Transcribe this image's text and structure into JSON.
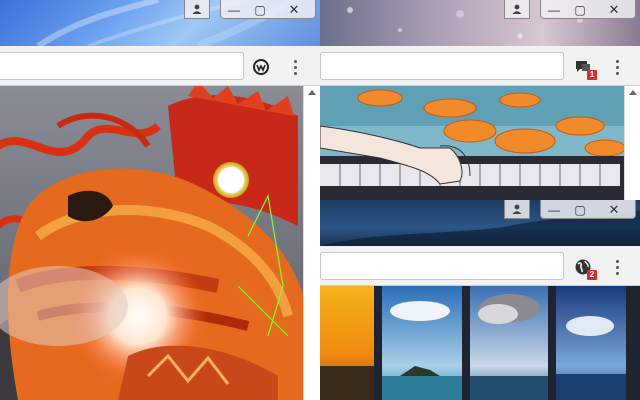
{
  "windows": [
    {
      "id": "dragon",
      "icons": {
        "profile": "person-icon",
        "extension": "workplace-icon"
      },
      "menu_label": "⋮"
    },
    {
      "id": "koi",
      "icons": {
        "profile": "person-icon",
        "extension": "chat-bubble-icon"
      },
      "badge": "1"
    },
    {
      "id": "sea",
      "icons": {
        "profile": "person-icon",
        "extension": "globe-icon"
      },
      "badge": "2"
    }
  ],
  "controls": {
    "minimize": "—",
    "maximize": "▢",
    "close": "✕"
  }
}
